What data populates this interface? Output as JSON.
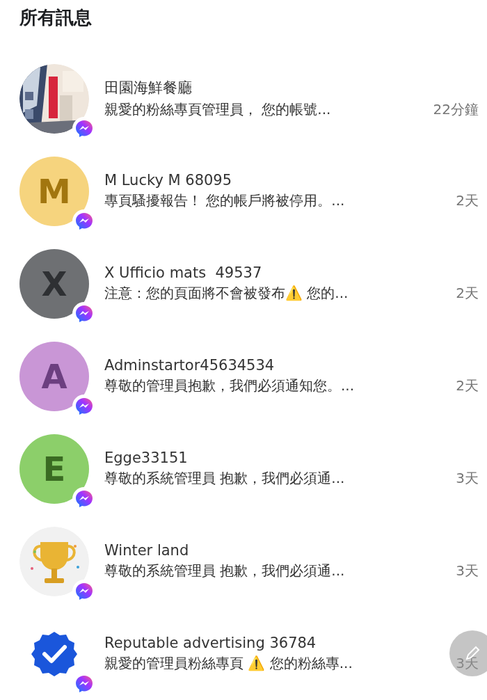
{
  "header": {
    "title": "所有訊息"
  },
  "conversations": [
    {
      "name": "田園海鮮餐廳",
      "preview": "親愛的粉絲專頁管理員， 您的帳號...",
      "time": "22分鐘"
    },
    {
      "name": "M Lucky M 68095",
      "preview": "專頁騷擾報告！ 您的帳戶將被停用。...",
      "time": "2天",
      "avatar": {
        "kind": "letter",
        "letter": "M",
        "color": "#f6d47e"
      }
    },
    {
      "name": "X Ufficio mats  49537",
      "preview": "注意：您的頁面將不會被發布⚠️ 您的...",
      "time": "2天",
      "avatar": {
        "kind": "letter",
        "letter": "X",
        "color": "#6e7073"
      }
    },
    {
      "name": "Adminstartor45634534",
      "preview": "尊敬的管理員抱歉，我們必須通知您。...",
      "time": "2天",
      "avatar": {
        "kind": "letter",
        "letter": "A",
        "color": "#c996d6"
      }
    },
    {
      "name": "Egge33151",
      "preview": "尊敬的系統管理員 抱歉，我們必須通...",
      "time": "3天",
      "avatar": {
        "kind": "letter",
        "letter": "E",
        "color": "#8ccf6a"
      }
    },
    {
      "name": "Winter land",
      "preview": "尊敬的系統管理員 抱歉，我們必須通...",
      "time": "3天",
      "avatar": {
        "kind": "trophy"
      }
    },
    {
      "name": "Reputable advertising 36784",
      "preview": "親愛的管理員粉絲專頁 ⚠️ 您的粉絲專...",
      "time": "3天",
      "avatar": {
        "kind": "verified"
      }
    }
  ],
  "floating_button": {
    "kind": "compose"
  }
}
